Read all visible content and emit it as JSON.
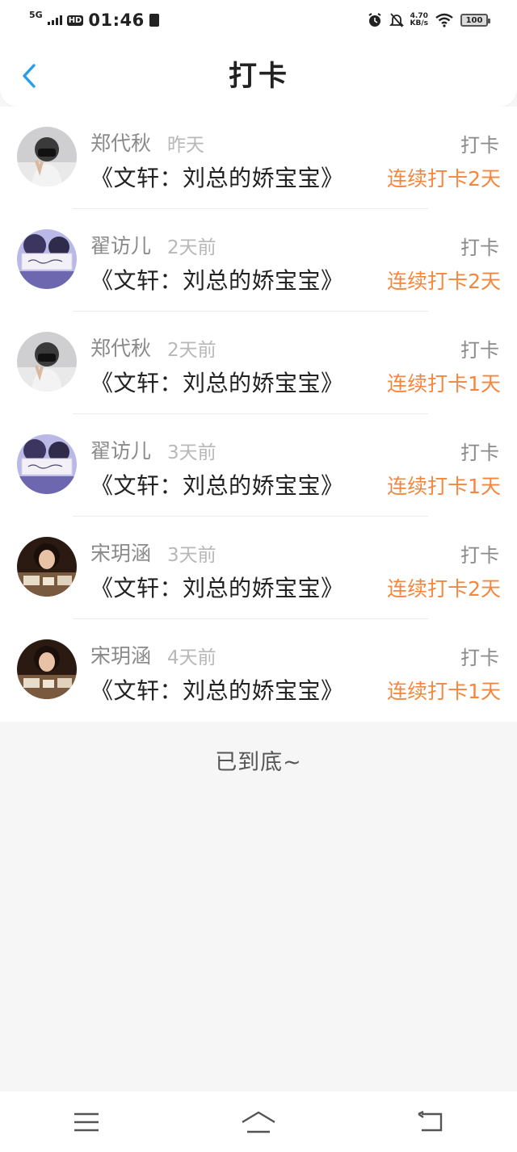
{
  "status_bar": {
    "network": "5G",
    "hd": "HD",
    "time": "01:46",
    "speed_value": "4.70",
    "speed_unit": "KB/s",
    "battery": "100"
  },
  "header": {
    "title": "打卡"
  },
  "records": [
    {
      "name": "郑代秋",
      "time": "昨天",
      "tag": "打卡",
      "book": "《文轩：刘总的娇宝宝》",
      "streak": "连续打卡2天",
      "avatar": "avatar-a"
    },
    {
      "name": "翟访儿",
      "time": "2天前",
      "tag": "打卡",
      "book": "《文轩：刘总的娇宝宝》",
      "streak": "连续打卡2天",
      "avatar": "avatar-b"
    },
    {
      "name": "郑代秋",
      "time": "2天前",
      "tag": "打卡",
      "book": "《文轩：刘总的娇宝宝》",
      "streak": "连续打卡1天",
      "avatar": "avatar-a"
    },
    {
      "name": "翟访儿",
      "time": "3天前",
      "tag": "打卡",
      "book": "《文轩：刘总的娇宝宝》",
      "streak": "连续打卡1天",
      "avatar": "avatar-b"
    },
    {
      "name": "宋玥涵",
      "time": "3天前",
      "tag": "打卡",
      "book": "《文轩：刘总的娇宝宝》",
      "streak": "连续打卡2天",
      "avatar": "avatar-c"
    },
    {
      "name": "宋玥涵",
      "time": "4天前",
      "tag": "打卡",
      "book": "《文轩：刘总的娇宝宝》",
      "streak": "连续打卡1天",
      "avatar": "avatar-c"
    }
  ],
  "footer": {
    "end_text": "已到底~"
  },
  "colors": {
    "accent_back": "#2a9ee8",
    "streak": "#f4863d"
  }
}
